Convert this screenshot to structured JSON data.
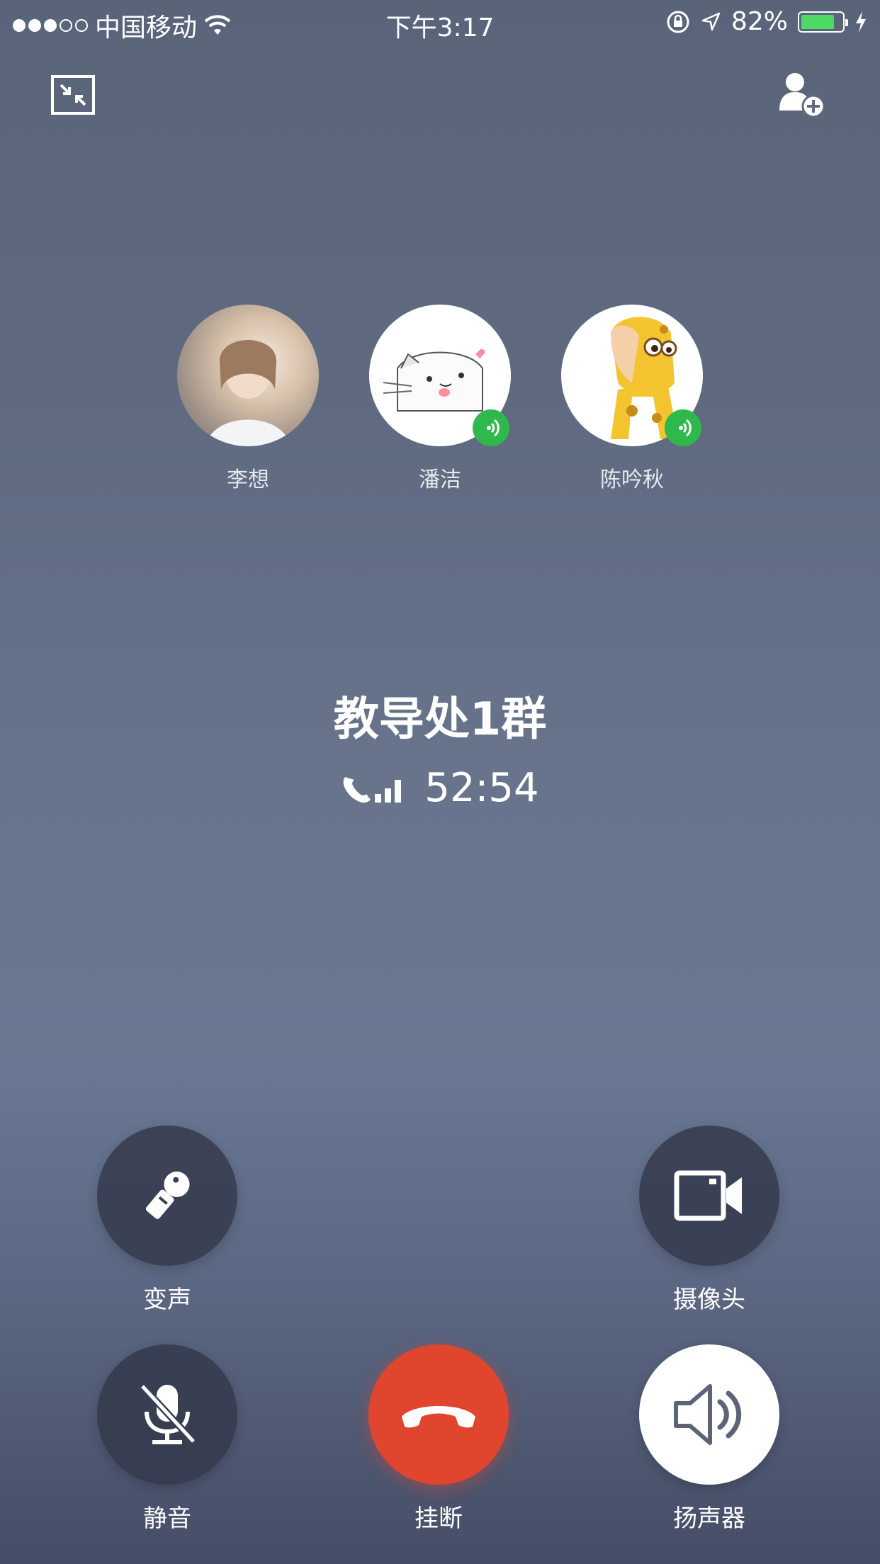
{
  "status_bar": {
    "carrier": "中国移动",
    "time": "下午3:17",
    "battery_percent": "82%",
    "battery_level": 0.82,
    "signal_dots_filled": 3,
    "signal_dots_total": 5
  },
  "header": {
    "minimize_icon": "minimize-window-icon",
    "add_member_icon": "add-member-icon"
  },
  "participants": [
    {
      "name": "李想",
      "speaking": false
    },
    {
      "name": "潘洁",
      "speaking": true
    },
    {
      "name": "陈吟秋",
      "speaking": true
    }
  ],
  "call": {
    "group_name": "教导处1群",
    "duration": "52:54"
  },
  "controls": {
    "voice_changer": "变声",
    "camera": "摄像头",
    "mute": "静音",
    "hang_up": "挂断",
    "speaker": "扬声器"
  },
  "colors": {
    "hangup": "#e0452e",
    "speaking_badge": "#2fb84b",
    "battery_fill": "#4cd964"
  }
}
